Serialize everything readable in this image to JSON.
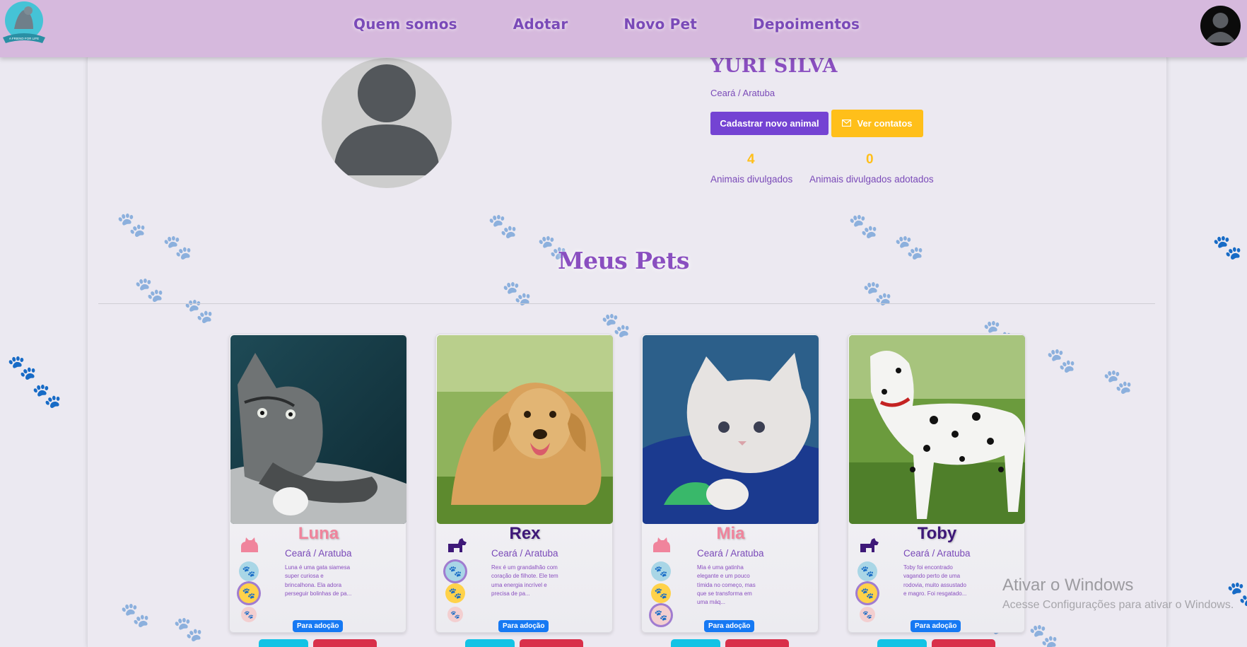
{
  "header": {
    "logo_text": "A FRIEND FOR LIFE",
    "nav": [
      "Quem somos",
      "Adotar",
      "Novo Pet",
      "Depoimentos"
    ]
  },
  "profile": {
    "name": "YURI SILVA",
    "location": "Ceará / Aratuba",
    "new_animal_button": "Cadastrar novo animal",
    "contacts_button": "Ver contatos",
    "stats": [
      {
        "value": "4",
        "label": "Animais divulgados"
      },
      {
        "value": "0",
        "label": "Animais divulgados adotados"
      }
    ]
  },
  "section_title": "Meus Pets",
  "pets": [
    {
      "name": "Luna",
      "species": "cat",
      "name_color": "#f0849c",
      "location": "Ceará / Aratuba",
      "description": "Luna é uma gata siamesa super curiosa e brincalhona. Ela adora perseguir bolinhas de pa...",
      "badge": "Para adoção",
      "highlight_trait": 1
    },
    {
      "name": "Rex",
      "species": "dog",
      "name_color": "#3e1878",
      "location": "Ceará / Aratuba",
      "description": "Rex é um grandalhão com coração de filhote. Ele tem uma energia incrível e precisa de pa...",
      "badge": "Para adoção",
      "highlight_trait": 0
    },
    {
      "name": "Mia",
      "species": "cat",
      "name_color": "#f0849c",
      "location": "Ceará / Aratuba",
      "description": "Mia é uma gatinha elegante e um pouco tímida no começo, mas que se transforma em uma máq...",
      "badge": "Para adoção",
      "highlight_trait": 2
    },
    {
      "name": "Toby",
      "species": "dog",
      "name_color": "#3e1878",
      "location": "Ceará / Aratuba",
      "description": "Toby foi encontrado vagando perto de uma rodovia, muito assustado e magro. Foi resgatado...",
      "badge": "Para adoção",
      "highlight_trait": 1
    }
  ],
  "watermark": {
    "line1": "Ativar o Windows",
    "line2": "Acesse Configurações para ativar o Windows."
  },
  "colors": {
    "header": "#d6b9dd",
    "accent_purple": "#7443d3",
    "accent_yellow": "#ffbf1a",
    "badge_blue": "#1679f3"
  }
}
